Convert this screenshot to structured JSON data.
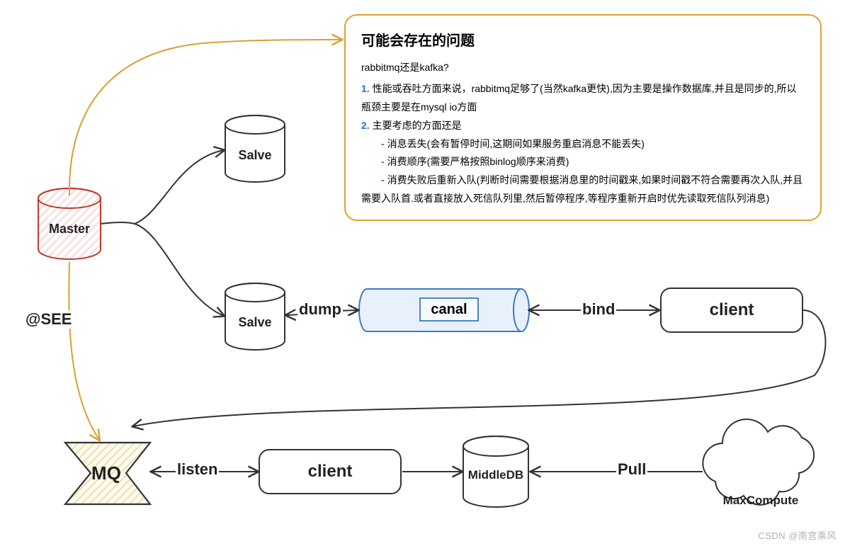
{
  "nodes": {
    "master": "Master",
    "slave1": "Salve",
    "slave2": "Salve",
    "canal": "canal",
    "client_top": "client",
    "client_bottom": "client",
    "mq": "MQ",
    "middledb": "MiddleDB",
    "maxcompute": "MaxCompute"
  },
  "edges": {
    "see": "@SEE",
    "dump": "dump",
    "bind": "bind",
    "listen": "listen",
    "pull": "Pull"
  },
  "note": {
    "title": "可能会存在的问题",
    "subtitle": "rabbitmq还是kafka?",
    "p1_num": "1.",
    "p1": "性能或吞吐方面来说，rabbitmq足够了(当然kafka更快),因为主要是操作数据库,并且是同步的,所以瓶颈主要是在mysql io方面",
    "p2_num": "2.",
    "p2": "主要考虑的方面还是",
    "b1": "消息丢失(会有暂停时间,这期间如果服务重启消息不能丢失)",
    "b2": "消费顺序(需要严格按照binlog顺序来消费)",
    "b3": "消费失败后重新入队(判断时间需要根据消息里的时间戳来,如果时间戳不符合需要再次入队,并且需要入队首.或者直接放入死信队列里,然后暂停程序,等程序重新开启时优先读取死信队列消息)"
  },
  "watermark": "CSDN @南宫乘风"
}
